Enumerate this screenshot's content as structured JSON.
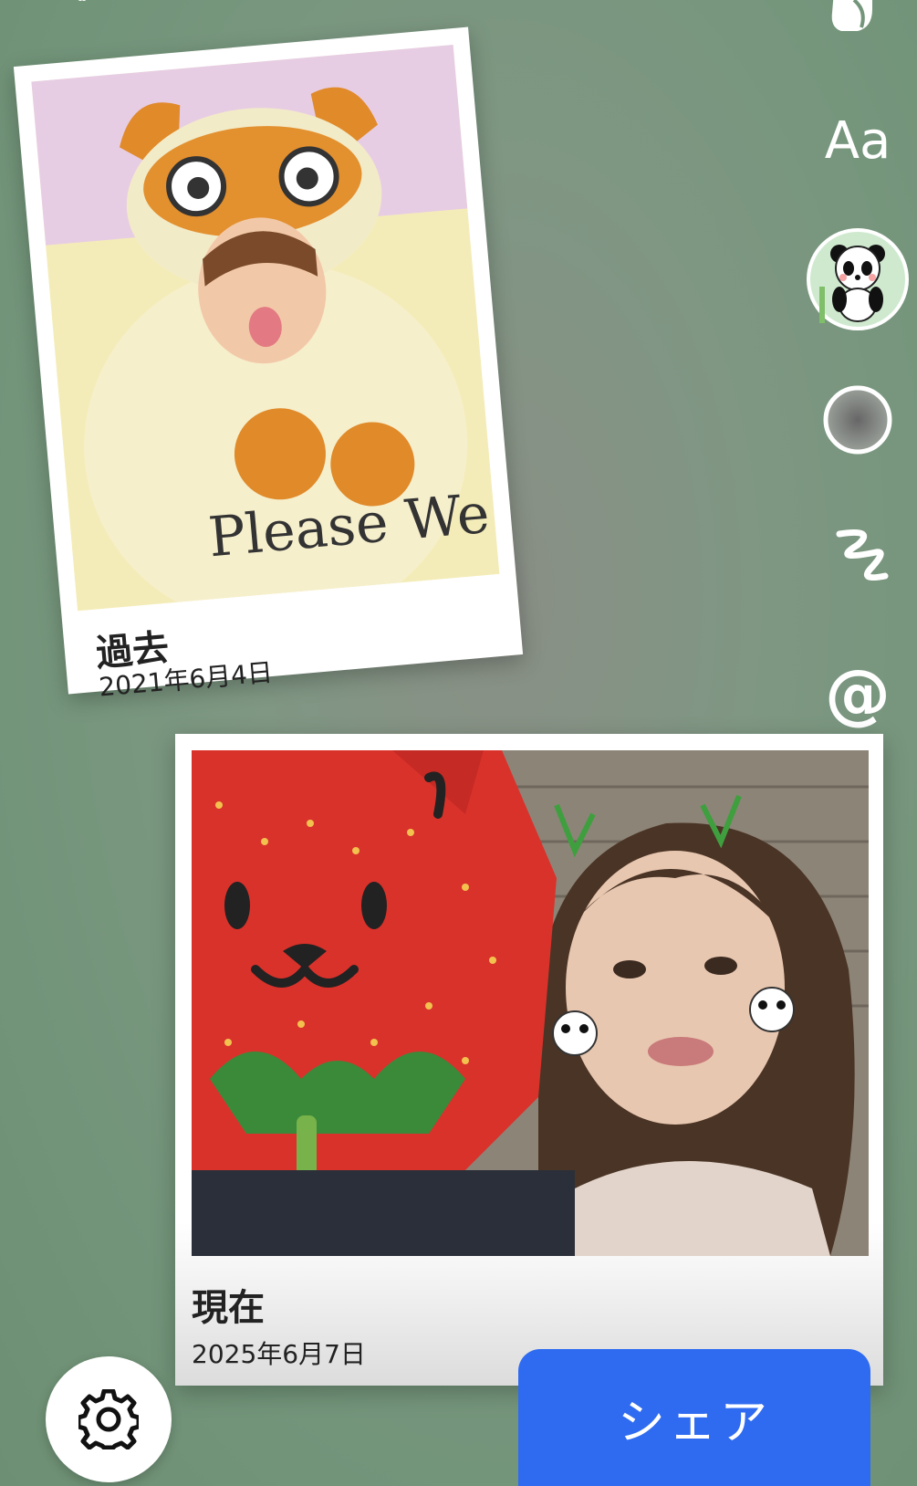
{
  "past_card": {
    "title": "過去",
    "date": "2021年6月4日",
    "photo_text": "Please We're"
  },
  "present_card": {
    "title": "現在",
    "date": "2025年6月7日"
  },
  "toolbar": {
    "text_tool_label": "Aa",
    "mention_label": "@"
  },
  "share_label": "シェア",
  "colors": {
    "share": "#2f6bf0",
    "background": "#73957a"
  }
}
